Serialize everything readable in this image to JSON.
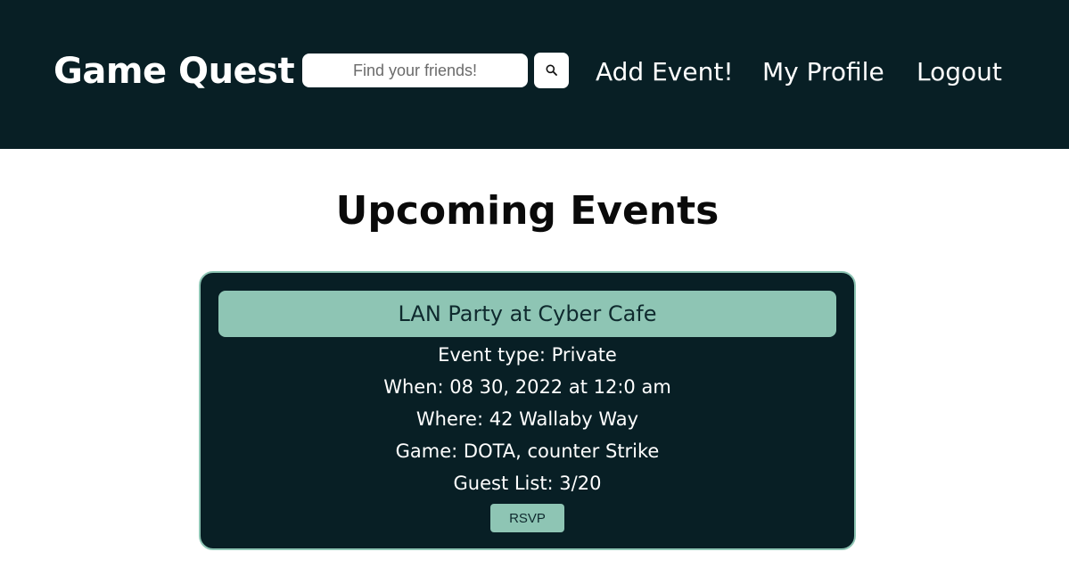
{
  "navbar": {
    "brand": "Game Quest",
    "search": {
      "placeholder": "Find your friends!",
      "value": "",
      "button_icon": "search-icon"
    },
    "links": {
      "add_event": "Add Event!",
      "my_profile": "My Profile",
      "logout": "Logout"
    }
  },
  "main": {
    "title": "Upcoming Events",
    "events": [
      {
        "title": "LAN Party at Cyber Cafe",
        "type_line": "Event type: Private",
        "when_line": "When: 08 30, 2022 at 12:0 am",
        "where_line": "Where: 42 Wallaby Way",
        "game_line": "Game: DOTA, counter Strike",
        "guests_line": "Guest List: 3/20",
        "rsvp_label": "RSVP"
      }
    ]
  },
  "colors": {
    "navbar_bg": "#081f25",
    "accent": "#8ec5b4",
    "card_bg": "#081f25",
    "page_bg": "#ffffff"
  }
}
